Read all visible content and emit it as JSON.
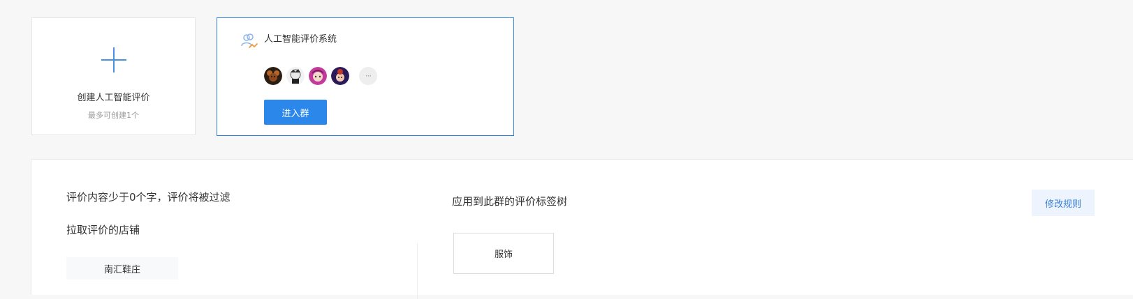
{
  "create_card": {
    "title": "创建人工智能评价",
    "subtitle": "最多可创建1个",
    "icon": "plus-icon"
  },
  "group_card": {
    "name": "人工智能评价系统",
    "icon": "users-group-icon",
    "avatars": [
      "avatar-1",
      "avatar-2",
      "avatar-3",
      "avatar-4"
    ],
    "more_label": "···",
    "enter_button": "进入群",
    "accent_color": "#2b7fe0"
  },
  "rules": {
    "filter_text": "评价内容少于0个字，评价将被过滤",
    "stores_label": "拉取评价的店铺",
    "stores": [
      "南汇鞋庄"
    ],
    "tag_tree_label": "应用到此群的评价标签树",
    "tags": [
      "服饰"
    ],
    "modify_button": "修改规则"
  }
}
